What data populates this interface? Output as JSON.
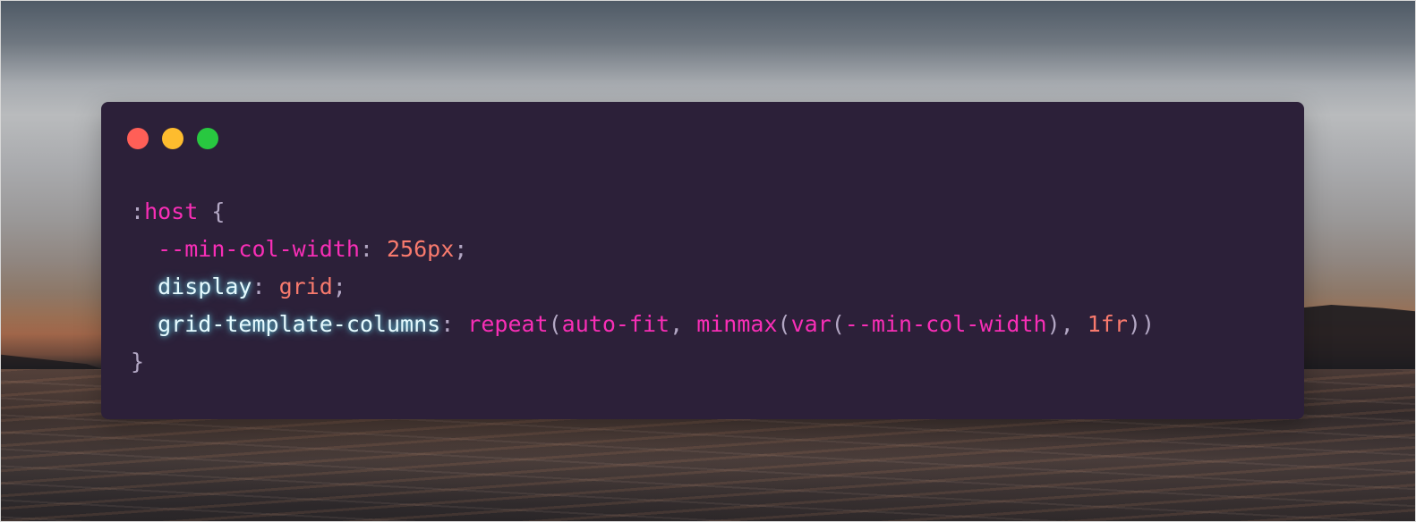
{
  "window": {
    "controls": {
      "close": "close-dot",
      "minimize": "minimize-dot",
      "maximize": "maximize-dot",
      "colors": {
        "close": "#ff5f57",
        "minimize": "#febc2e",
        "maximize": "#28c840"
      }
    },
    "background_color": "#2c2039"
  },
  "code": {
    "line1": {
      "colon": ":",
      "selector": "host",
      "brace": " {"
    },
    "line2": {
      "indent": "  ",
      "property": "--min-col-width",
      "colon": ": ",
      "value": "256px",
      "semi": ";"
    },
    "line3": {
      "indent": "  ",
      "property": "display",
      "colon": ": ",
      "value": "grid",
      "semi": ";"
    },
    "line4": {
      "indent": "  ",
      "property": "grid-template-columns",
      "colon": ": ",
      "fn_repeat": "repeat",
      "open1": "(",
      "kw_autofit": "auto-fit",
      "comma1": ", ",
      "fn_minmax": "minmax",
      "open2": "(",
      "fn_var": "var",
      "open3": "(",
      "var_name": "--min-col-width",
      "close3": ")",
      "comma2": ", ",
      "fr_value": "1fr",
      "close_all": "))"
    },
    "line5": {
      "brace": "}"
    },
    "colors": {
      "punctuation": "#b3a7c4",
      "pink": "#f82eb6",
      "orange": "#f87a6d",
      "glow_property": "#e6fbff"
    }
  }
}
